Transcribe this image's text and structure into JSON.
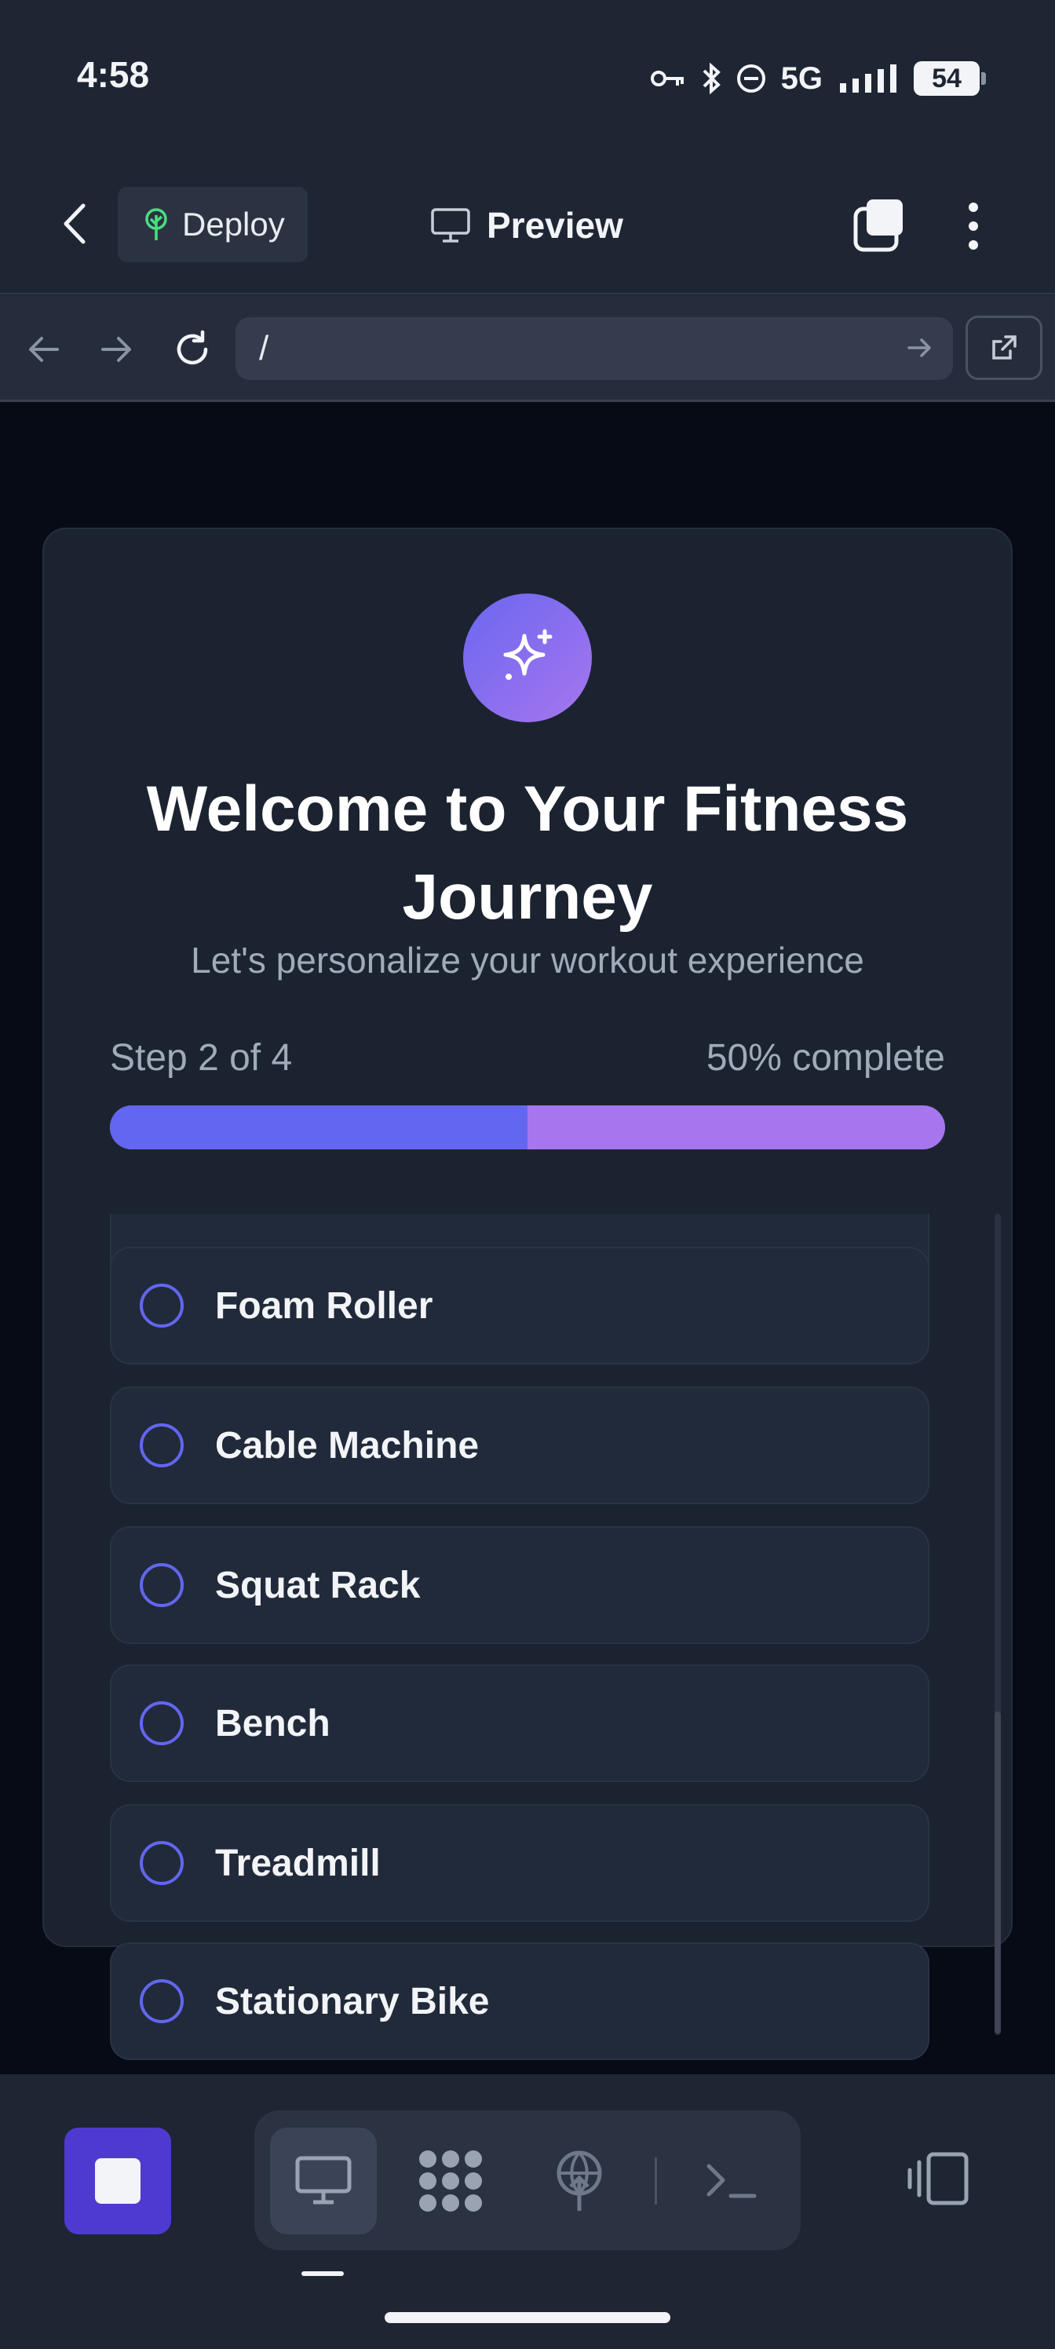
{
  "status_bar": {
    "time": "4:58",
    "network": "5G",
    "battery": "54"
  },
  "app_bar": {
    "deploy_label": "Deploy",
    "preview_label": "Preview"
  },
  "browser": {
    "url": "/"
  },
  "onboarding": {
    "title": "Welcome to Your Fitness Journey",
    "subtitle": "Let's personalize your workout experience",
    "step_label": "Step 2 of 4",
    "progress_label": "50% complete",
    "progress_fraction": 0.5,
    "options": [
      {
        "label": "Foam Roller",
        "selected": false
      },
      {
        "label": "Cable Machine",
        "selected": false
      },
      {
        "label": "Squat Rack",
        "selected": false
      },
      {
        "label": "Bench",
        "selected": false
      },
      {
        "label": "Treadmill",
        "selected": false
      },
      {
        "label": "Stationary Bike",
        "selected": false
      }
    ]
  },
  "colors": {
    "accent": "#6366f1",
    "accent_secondary": "#a776ee",
    "stop_button": "#4f3ad1"
  },
  "icons": {
    "back": "chevron-left-icon",
    "deploy": "tree-icon",
    "preview": "monitor-icon",
    "badge": "sparkles-icon",
    "toolbar": [
      "monitor-icon",
      "components-icon",
      "deploy-icon",
      "terminal-icon"
    ]
  }
}
